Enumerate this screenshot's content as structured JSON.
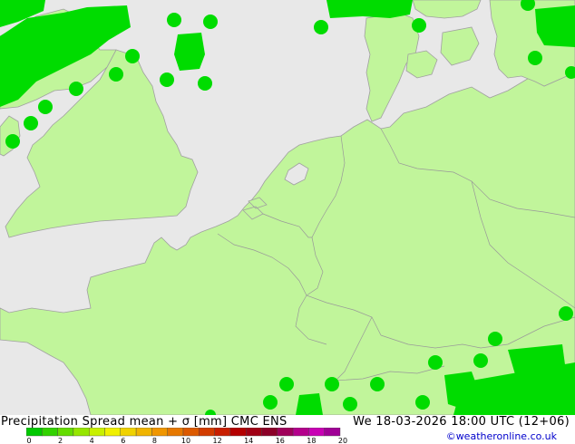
{
  "header": {
    "product_title": "Precipitation Spread mean + σ [mm] CMC ENS",
    "valid_time": "We 18-03-2026 18:00 UTC (12+06)"
  },
  "footer": {
    "credit": "©weatheronline.co.uk"
  },
  "legend": {
    "tick_labels": [
      "0",
      "2",
      "4",
      "6",
      "8",
      "10",
      "12",
      "14",
      "16",
      "18",
      "20"
    ],
    "colors": [
      "#00c800",
      "#32d200",
      "#64dc00",
      "#96e600",
      "#c8f000",
      "#f0f000",
      "#f0d200",
      "#f0b400",
      "#f09600",
      "#e67800",
      "#dc5a00",
      "#d23c00",
      "#c81e00",
      "#b40000",
      "#a00014",
      "#8c0028",
      "#a0005a",
      "#b4008c",
      "#c800b4",
      "#a00096"
    ]
  },
  "map": {
    "colors": {
      "sea": "#e8e8e8",
      "land_precip_low": "#c1f59b",
      "precip_cell": "#00dc00",
      "coastline": "#a0a0a0",
      "border": "#999999"
    }
  }
}
